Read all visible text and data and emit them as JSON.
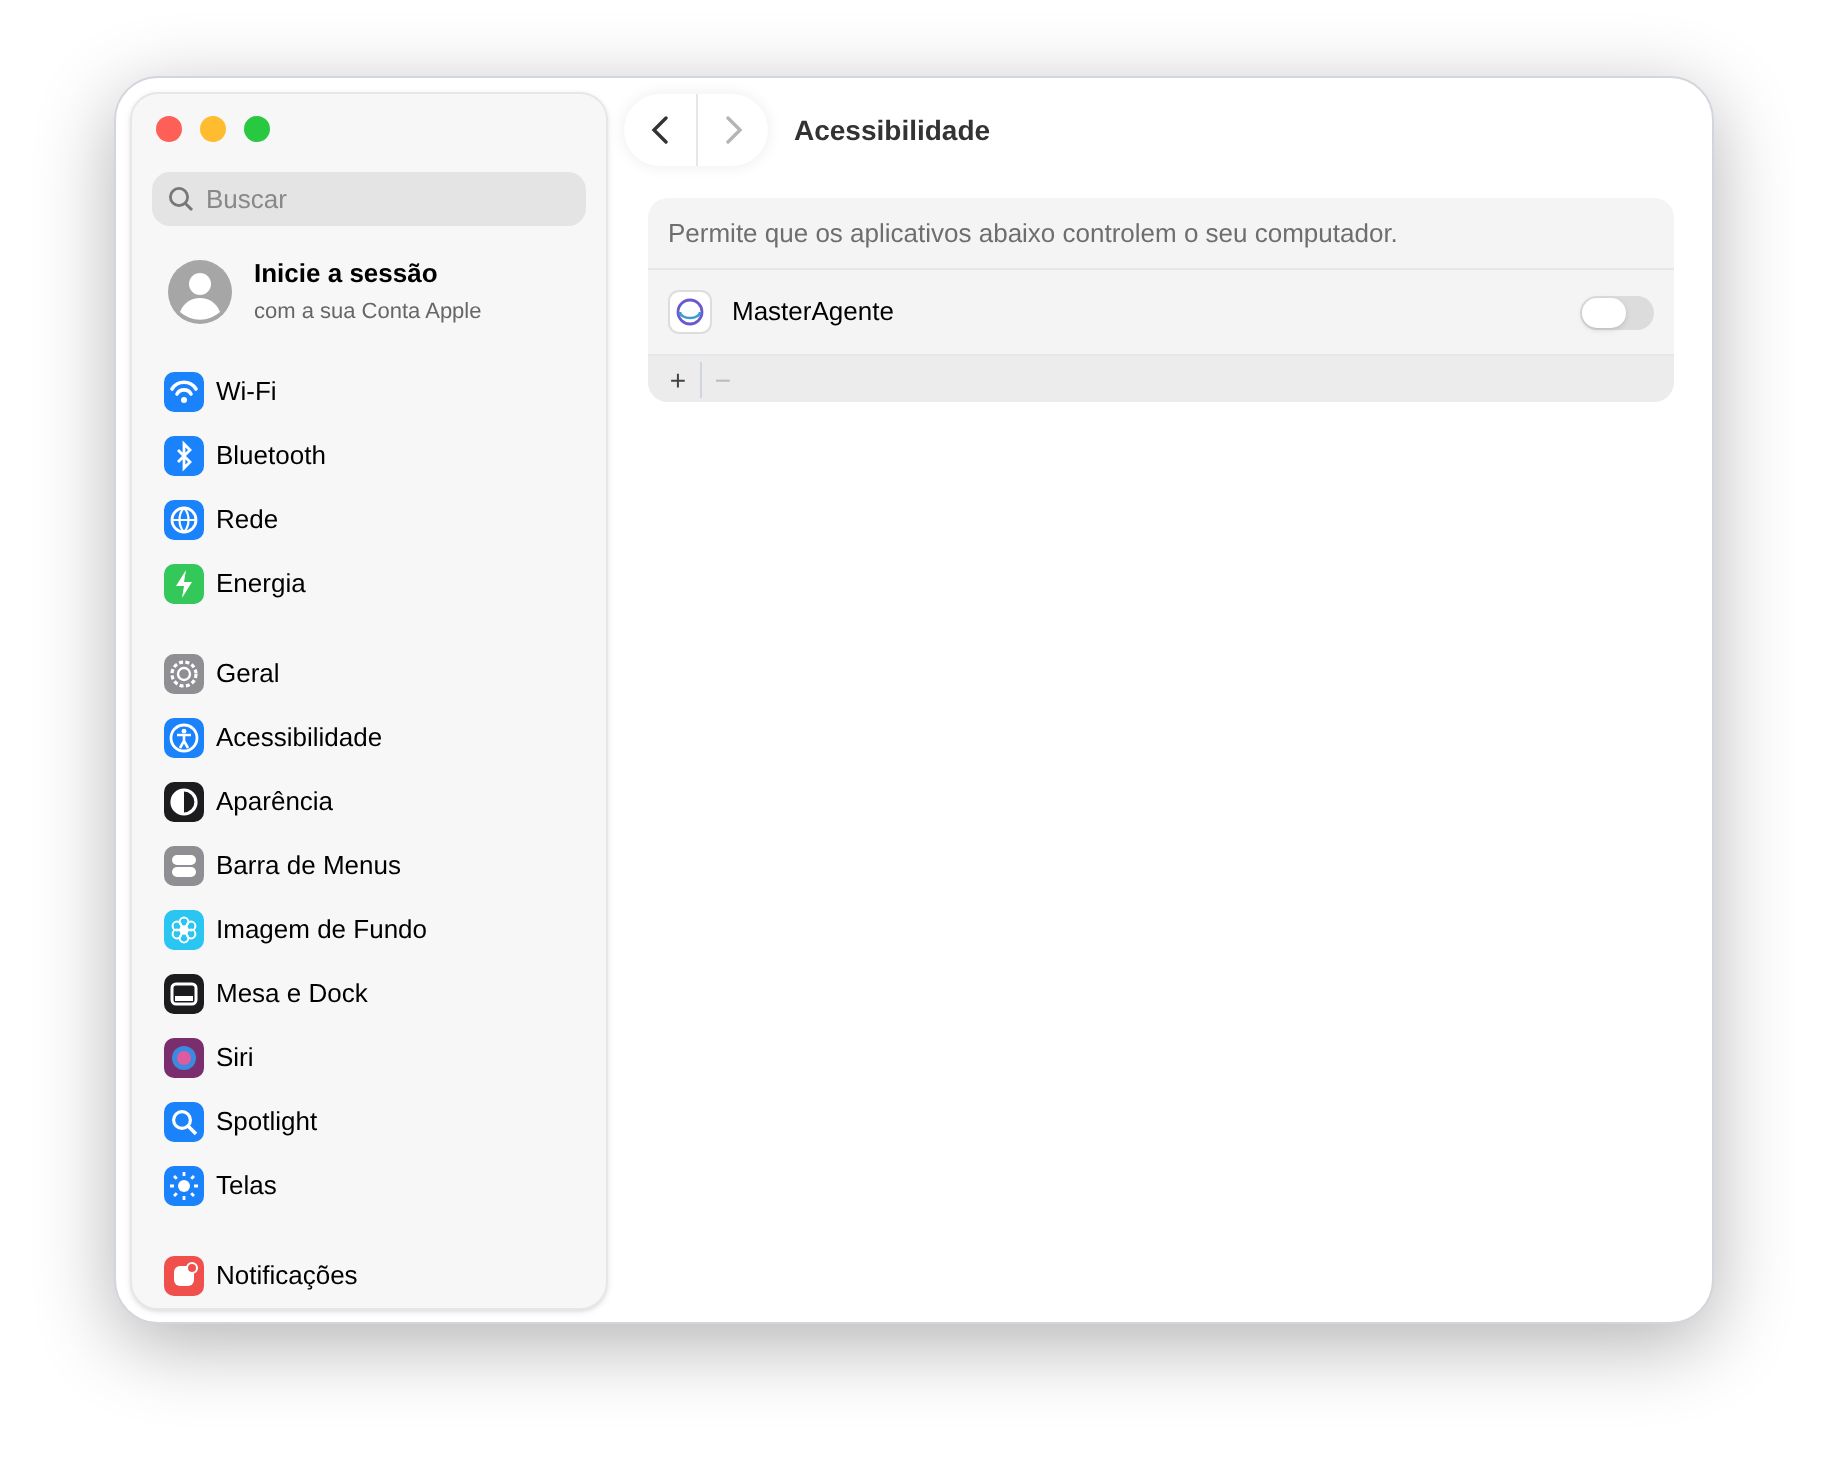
{
  "window": {
    "title": "Acessibilidade",
    "traffic_lights": [
      {
        "color": "#fe5f57"
      },
      {
        "color": "#febc2e"
      },
      {
        "color": "#28c840"
      }
    ]
  },
  "navigation": [
    {
      "kind": "back",
      "disabled": false
    },
    {
      "kind": "forward",
      "disabled": true
    }
  ],
  "search": {
    "placeholder": "Buscar"
  },
  "account": {
    "title": "Inicie a sessão",
    "subtitle": "com a sua Conta Apple"
  },
  "sidebar": {
    "groups": [
      {
        "items": [
          {
            "label": "Wi-Fi",
            "color": "#1a82fb"
          },
          {
            "label": "Bluetooth",
            "color": "#1a82fb"
          },
          {
            "label": "Rede",
            "color": "#1a82fb"
          },
          {
            "label": "Energia",
            "color": "#34c759"
          }
        ]
      },
      {
        "items": [
          {
            "label": "Geral",
            "color": "#8e8e93"
          },
          {
            "label": "Acessibilidade",
            "color": "#1a82fb"
          },
          {
            "label": "Aparência",
            "color": "#1c1c1e"
          },
          {
            "label": "Barra de Menus",
            "color": "#8e8e93"
          },
          {
            "label": "Imagem de Fundo",
            "color": "#2ac5f0"
          },
          {
            "label": "Mesa e Dock",
            "color": "#1c1c1e"
          },
          {
            "label": "Siri",
            "color": "#7a2e6e"
          },
          {
            "label": "Spotlight",
            "color": "#1a82fb"
          },
          {
            "label": "Telas",
            "color": "#1a82fb"
          }
        ]
      },
      {
        "items": [
          {
            "label": "Notificações",
            "color": "#f0504c"
          }
        ]
      }
    ]
  },
  "panel": {
    "description": "Permite que os aplicativos abaixo controlem o seu computador.",
    "apps": [
      {
        "name": "MasterAgente",
        "on": false
      }
    ],
    "footer_buttons": [
      {
        "label": "+",
        "disabled": false
      },
      {
        "label": "−",
        "disabled": true
      }
    ]
  }
}
